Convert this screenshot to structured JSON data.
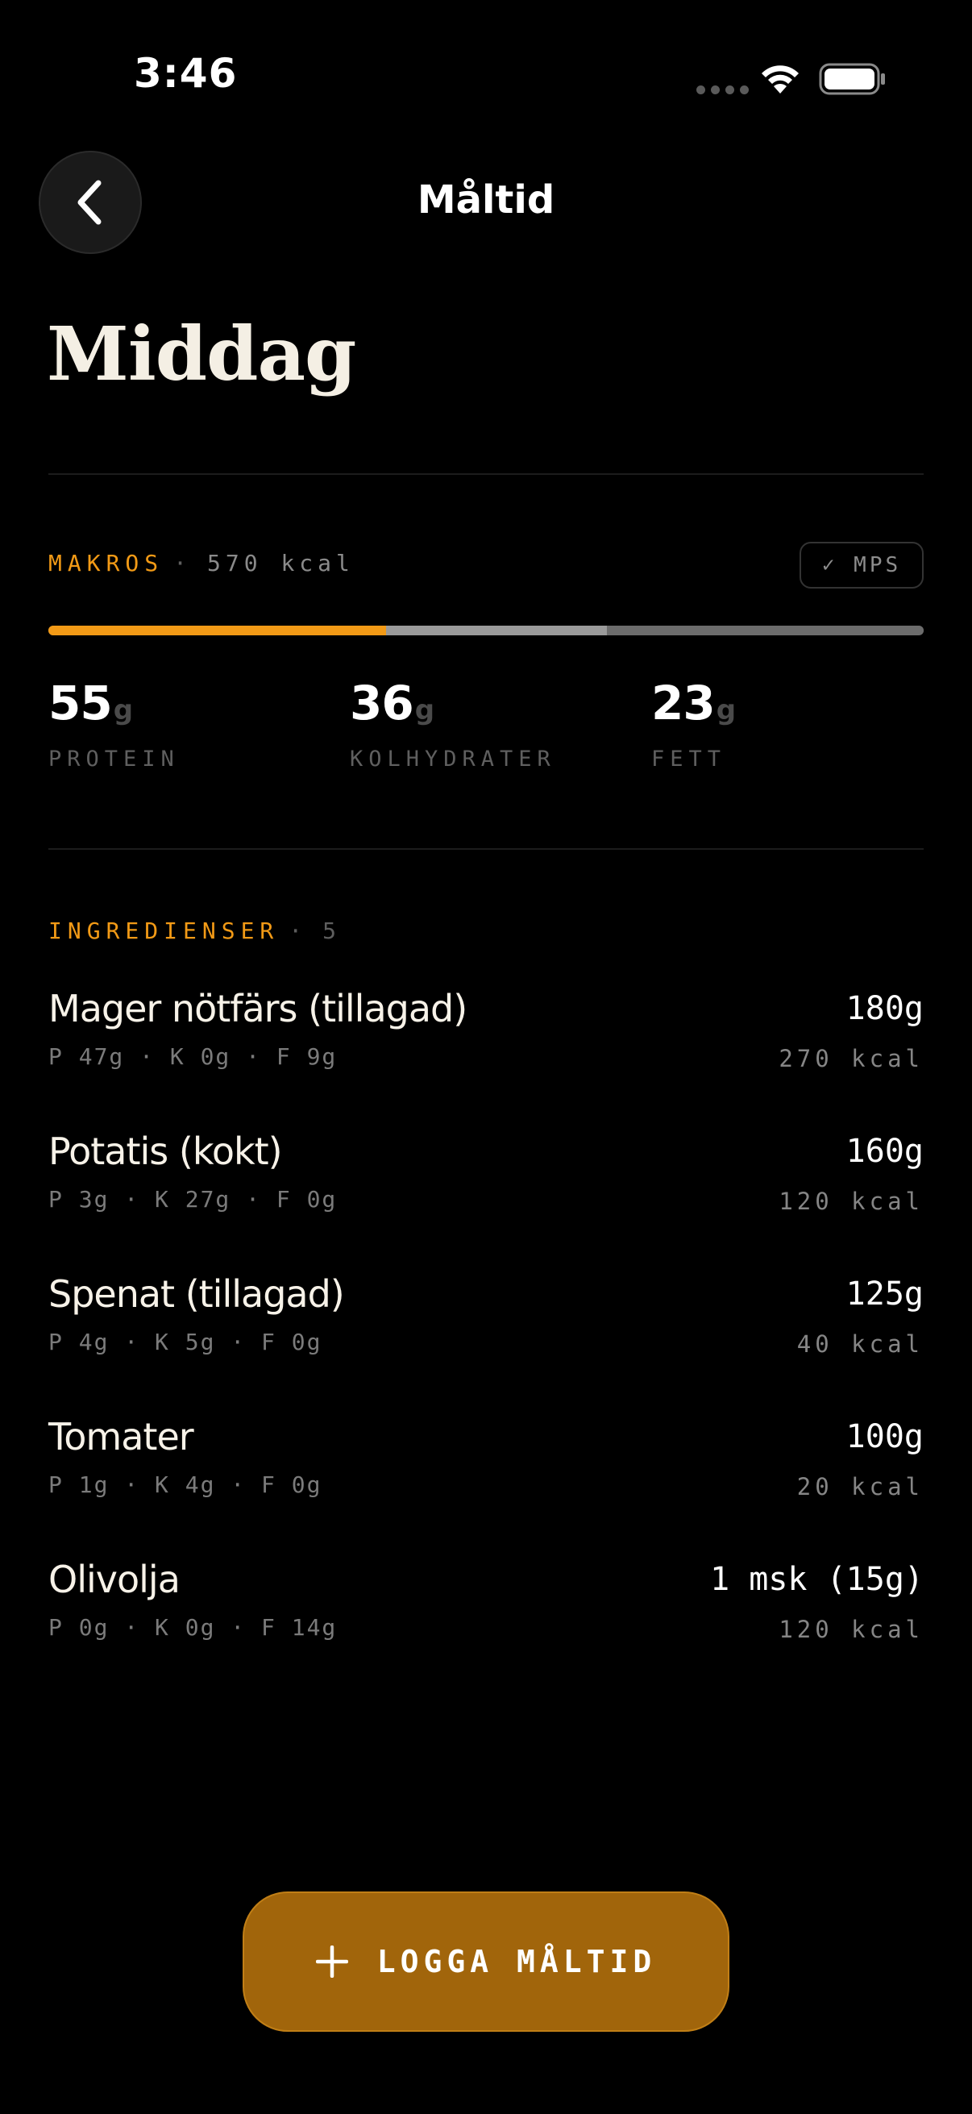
{
  "status_bar": {
    "time": "3:46"
  },
  "header": {
    "title": "Måltid",
    "back_icon": "chevron-left-icon"
  },
  "meal": {
    "title": "Middag"
  },
  "makros": {
    "label": "MAKROS",
    "separator": "·",
    "kcal": "570 kcal",
    "badge": "✓ MPS",
    "bar": {
      "colors": [
        "#f29a16",
        "#9a9a9a",
        "#6c6c6c"
      ],
      "fractions": [
        0.386,
        0.252,
        0.362
      ]
    },
    "items": [
      {
        "value": "55",
        "unit": "g",
        "label": "PROTEIN"
      },
      {
        "value": "36",
        "unit": "g",
        "label": "KOLHYDRATER"
      },
      {
        "value": "23",
        "unit": "g",
        "label": "FETT"
      }
    ]
  },
  "ingredients": {
    "label": "INGREDIENSER",
    "separator": "·",
    "count": "5",
    "items": [
      {
        "name": "Mager nötfärs (tillagad)",
        "macros": "P 47g · K 0g · F 9g",
        "amount": "180g",
        "kcal": "270 kcal"
      },
      {
        "name": "Potatis (kokt)",
        "macros": "P 3g · K 27g · F 0g",
        "amount": "160g",
        "kcal": "120 kcal"
      },
      {
        "name": "Spenat (tillagad)",
        "macros": "P 4g · K 5g · F 0g",
        "amount": "125g",
        "kcal": "40 kcal"
      },
      {
        "name": "Tomater",
        "macros": "P 1g · K 4g · F 0g",
        "amount": "100g",
        "kcal": "20 kcal"
      },
      {
        "name": "Olivolja",
        "macros": "P 0g · K 0g · F 14g",
        "amount": "1 msk (15g)",
        "kcal": "120 kcal"
      }
    ]
  },
  "cta": {
    "label": "LOGGA MÅLTID",
    "icon": "plus-icon"
  },
  "colors": {
    "accent": "#f29a16",
    "cta_bg": "#a1650b",
    "background": "#000000"
  }
}
